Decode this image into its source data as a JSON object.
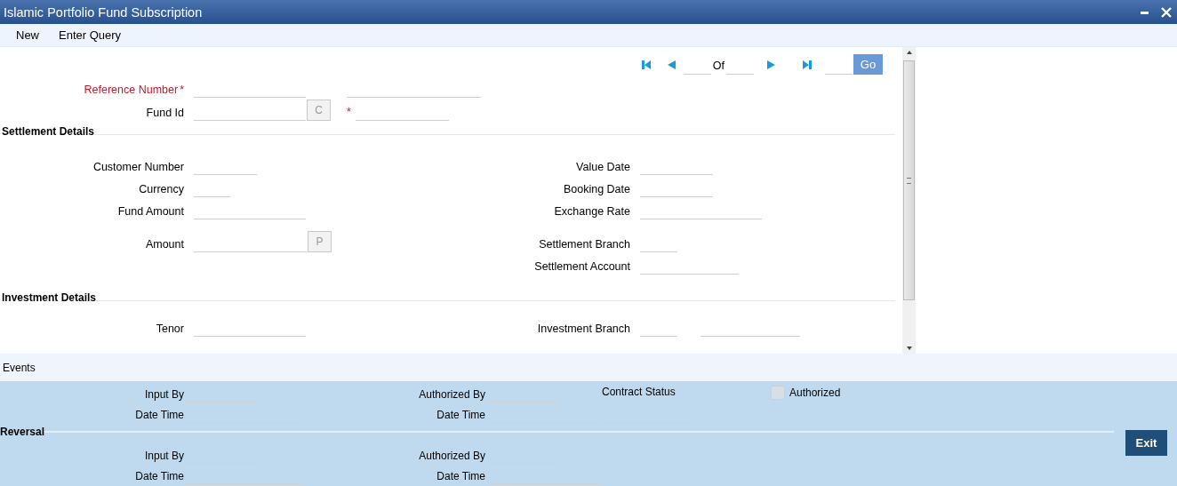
{
  "window": {
    "title": "Islamic Portfolio Fund Subscription"
  },
  "toolbar": [
    "New",
    "Enter Query"
  ],
  "navigator": {
    "of_label": "Of",
    "go_button": "Go"
  },
  "header_fields": [
    {
      "label": "Reference Number",
      "label_mark": "*",
      "required": true
    },
    {
      "label": "Fund Id",
      "required": false,
      "lookup_button": "C",
      "second_field_mark": "*"
    }
  ],
  "sections": [
    {
      "title": "Settlement Details",
      "left": [
        {
          "label": "Customer Number"
        },
        {
          "label": "Currency"
        },
        {
          "label": "Fund Amount"
        },
        {
          "label": "Amount",
          "lookup_button": "P"
        }
      ],
      "right": [
        {
          "label": "Value Date"
        },
        {
          "label": "Booking Date"
        },
        {
          "label": "Exchange Rate"
        },
        {
          "label": "Settlement Branch"
        },
        {
          "label": "Settlement Account"
        }
      ]
    },
    {
      "title": "Investment Details",
      "left": [
        {
          "label": "Tenor"
        }
      ],
      "right": [
        {
          "label": "Investment Branch"
        }
      ]
    }
  ],
  "events_label": "Events",
  "audit": {
    "left": [
      "Input By",
      "Date Time"
    ],
    "middle": [
      "Authorized By",
      "Date Time"
    ],
    "contract_status": "Contract Status",
    "authorized": {
      "label": "Authorized",
      "checked": false
    }
  },
  "reversal": {
    "title": "Reversal",
    "left": [
      "Input By",
      "Date Time"
    ],
    "middle": [
      "Authorized By",
      "Date Time"
    ]
  },
  "exit_button": "Exit"
}
